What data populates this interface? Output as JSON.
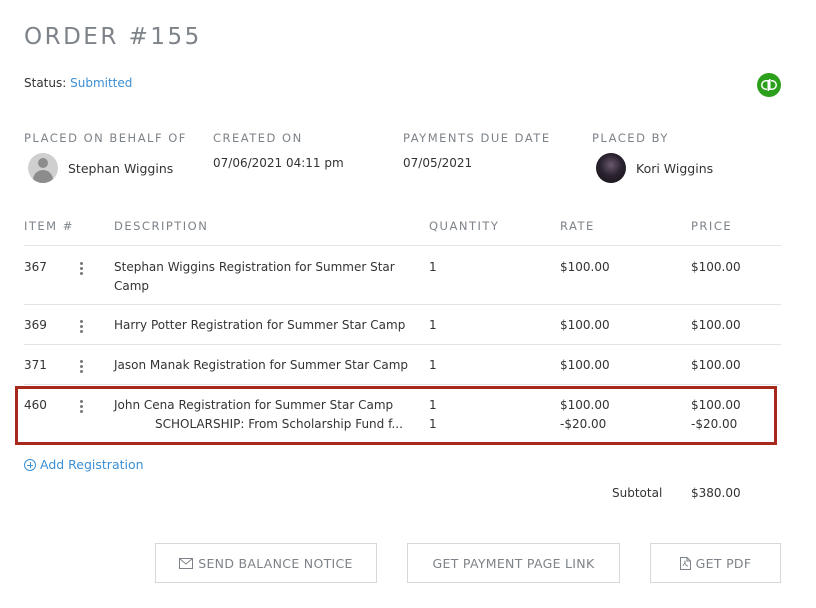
{
  "order": {
    "title": "ORDER #155",
    "status_label": "Status:",
    "status_value": "Submitted"
  },
  "meta": {
    "placed_on_behalf_of": {
      "label": "PLACED ON BEHALF OF",
      "name": "Stephan Wiggins"
    },
    "created_on": {
      "label": "CREATED ON",
      "value": "07/06/2021 04:11 pm"
    },
    "payments_due_date": {
      "label": "PAYMENTS DUE DATE",
      "value": "07/05/2021"
    },
    "placed_by": {
      "label": "PLACED BY",
      "name": "Kori Wiggins"
    }
  },
  "table": {
    "headers": {
      "item": "ITEM #",
      "description": "DESCRIPTION",
      "quantity": "QUANTITY",
      "rate": "RATE",
      "price": "PRICE"
    },
    "rows": [
      {
        "item": "367",
        "description": "Stephan Wiggins Registration for Summer Star Camp",
        "quantity": "1",
        "rate": "$100.00",
        "price": "$100.00"
      },
      {
        "item": "369",
        "description": "Harry Potter Registration for Summer Star Camp",
        "quantity": "1",
        "rate": "$100.00",
        "price": "$100.00"
      },
      {
        "item": "371",
        "description": "Jason Manak Registration for Summer Star Camp",
        "quantity": "1",
        "rate": "$100.00",
        "price": "$100.00"
      },
      {
        "item": "460",
        "description": "John Cena Registration for Summer Star Camp",
        "quantity": "1",
        "rate": "$100.00",
        "price": "$100.00",
        "sub": {
          "description": "SCHOLARSHIP: From Scholarship Fund f...",
          "quantity": "1",
          "rate": "-$20.00",
          "price": "-$20.00"
        }
      }
    ]
  },
  "add_registration": "Add Registration",
  "subtotal": {
    "label": "Subtotal",
    "value": "$380.00"
  },
  "buttons": {
    "send_balance_notice": "SEND BALANCE NOTICE",
    "get_payment_page_link": "GET PAYMENT PAGE LINK",
    "get_pdf": "GET PDF"
  },
  "colors": {
    "link": "#3b8fd4",
    "highlight_border": "#a8281c",
    "quickbooks": "#2ca01c"
  },
  "icons": {
    "quickbooks": "quickbooks-icon",
    "envelope": "envelope-icon",
    "pdf": "pdf-file-icon",
    "kebab": "kebab-menu-icon",
    "add": "plus-circle-icon"
  }
}
